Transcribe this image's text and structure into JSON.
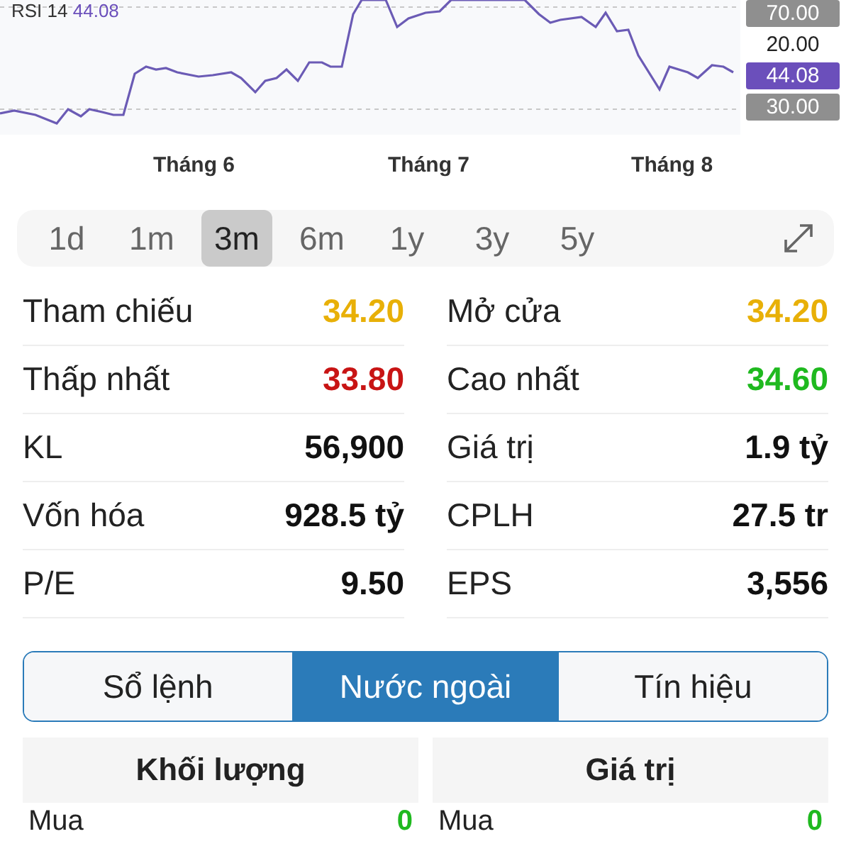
{
  "rsi_chart": {
    "label": "RSI 14",
    "value": "44.08",
    "axis_labels": [
      {
        "text": "70.00",
        "kind": "band"
      },
      {
        "text": "20.00",
        "kind": "plain"
      },
      {
        "text": "44.08",
        "kind": "current"
      },
      {
        "text": "30.00",
        "kind": "band"
      }
    ],
    "months": [
      "Tháng 6",
      "Tháng 7",
      "Tháng 8"
    ]
  },
  "periods": [
    {
      "label": "1d",
      "selected": false
    },
    {
      "label": "1m",
      "selected": false
    },
    {
      "label": "3m",
      "selected": true
    },
    {
      "label": "6m",
      "selected": false
    },
    {
      "label": "1y",
      "selected": false
    },
    {
      "label": "3y",
      "selected": false
    },
    {
      "label": "5y",
      "selected": false
    }
  ],
  "stats": [
    [
      {
        "label": "Tham chiếu",
        "value": "34.20",
        "color": "#e8b007"
      },
      {
        "label": "Mở cửa",
        "value": "34.20",
        "color": "#e8b007"
      }
    ],
    [
      {
        "label": "Thấp nhất",
        "value": "33.80",
        "color": "#c81414"
      },
      {
        "label": "Cao nhất",
        "value": "34.60",
        "color": "#1fb91f"
      }
    ],
    [
      {
        "label": "KL",
        "value": "56,900",
        "color": "#111111"
      },
      {
        "label": "Giá trị",
        "value": "1.9 tỷ",
        "color": "#111111"
      }
    ],
    [
      {
        "label": "Vốn hóa",
        "value": "928.5 tỷ",
        "color": "#111111"
      },
      {
        "label": "CPLH",
        "value": "27.5 tr",
        "color": "#111111"
      }
    ],
    [
      {
        "label": "P/E",
        "value": "9.50",
        "color": "#111111"
      },
      {
        "label": "EPS",
        "value": "3,556",
        "color": "#111111"
      }
    ]
  ],
  "tabs": [
    {
      "label": "Sổ lệnh",
      "selected": false
    },
    {
      "label": "Nước ngoài",
      "selected": true
    },
    {
      "label": "Tín hiệu",
      "selected": false
    }
  ],
  "foreign": [
    {
      "heading": "Khối lượng",
      "rows": [
        {
          "label": "Mua",
          "value": "0",
          "color": "#1fb91f"
        }
      ]
    },
    {
      "heading": "Giá trị",
      "rows": [
        {
          "label": "Mua",
          "value": "0",
          "color": "#1fb91f"
        }
      ]
    }
  ]
}
